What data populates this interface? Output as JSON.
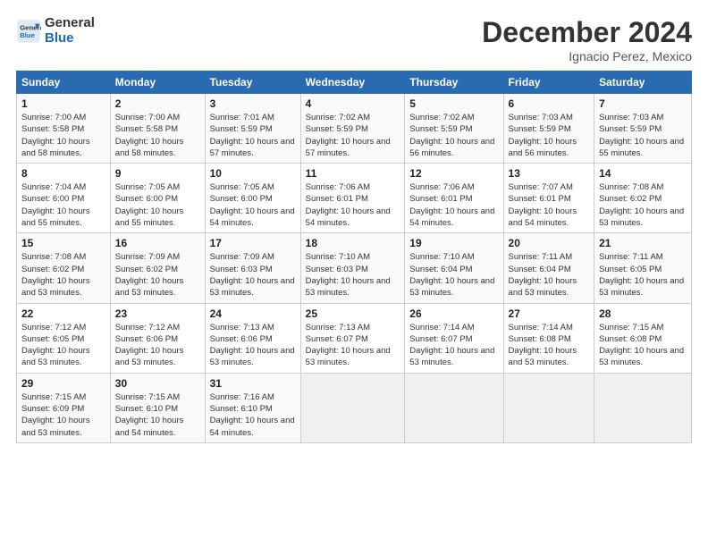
{
  "logo": {
    "general": "General",
    "blue": "Blue"
  },
  "header": {
    "title": "December 2024",
    "subtitle": "Ignacio Perez, Mexico"
  },
  "weekdays": [
    "Sunday",
    "Monday",
    "Tuesday",
    "Wednesday",
    "Thursday",
    "Friday",
    "Saturday"
  ],
  "weeks": [
    [
      {
        "day": "1",
        "sunrise": "7:00 AM",
        "sunset": "5:58 PM",
        "daylight": "10 hours and 58 minutes."
      },
      {
        "day": "2",
        "sunrise": "7:00 AM",
        "sunset": "5:58 PM",
        "daylight": "10 hours and 58 minutes."
      },
      {
        "day": "3",
        "sunrise": "7:01 AM",
        "sunset": "5:59 PM",
        "daylight": "10 hours and 57 minutes."
      },
      {
        "day": "4",
        "sunrise": "7:02 AM",
        "sunset": "5:59 PM",
        "daylight": "10 hours and 57 minutes."
      },
      {
        "day": "5",
        "sunrise": "7:02 AM",
        "sunset": "5:59 PM",
        "daylight": "10 hours and 56 minutes."
      },
      {
        "day": "6",
        "sunrise": "7:03 AM",
        "sunset": "5:59 PM",
        "daylight": "10 hours and 56 minutes."
      },
      {
        "day": "7",
        "sunrise": "7:03 AM",
        "sunset": "5:59 PM",
        "daylight": "10 hours and 55 minutes."
      }
    ],
    [
      {
        "day": "8",
        "sunrise": "7:04 AM",
        "sunset": "6:00 PM",
        "daylight": "10 hours and 55 minutes."
      },
      {
        "day": "9",
        "sunrise": "7:05 AM",
        "sunset": "6:00 PM",
        "daylight": "10 hours and 55 minutes."
      },
      {
        "day": "10",
        "sunrise": "7:05 AM",
        "sunset": "6:00 PM",
        "daylight": "10 hours and 54 minutes."
      },
      {
        "day": "11",
        "sunrise": "7:06 AM",
        "sunset": "6:01 PM",
        "daylight": "10 hours and 54 minutes."
      },
      {
        "day": "12",
        "sunrise": "7:06 AM",
        "sunset": "6:01 PM",
        "daylight": "10 hours and 54 minutes."
      },
      {
        "day": "13",
        "sunrise": "7:07 AM",
        "sunset": "6:01 PM",
        "daylight": "10 hours and 54 minutes."
      },
      {
        "day": "14",
        "sunrise": "7:08 AM",
        "sunset": "6:02 PM",
        "daylight": "10 hours and 53 minutes."
      }
    ],
    [
      {
        "day": "15",
        "sunrise": "7:08 AM",
        "sunset": "6:02 PM",
        "daylight": "10 hours and 53 minutes."
      },
      {
        "day": "16",
        "sunrise": "7:09 AM",
        "sunset": "6:02 PM",
        "daylight": "10 hours and 53 minutes."
      },
      {
        "day": "17",
        "sunrise": "7:09 AM",
        "sunset": "6:03 PM",
        "daylight": "10 hours and 53 minutes."
      },
      {
        "day": "18",
        "sunrise": "7:10 AM",
        "sunset": "6:03 PM",
        "daylight": "10 hours and 53 minutes."
      },
      {
        "day": "19",
        "sunrise": "7:10 AM",
        "sunset": "6:04 PM",
        "daylight": "10 hours and 53 minutes."
      },
      {
        "day": "20",
        "sunrise": "7:11 AM",
        "sunset": "6:04 PM",
        "daylight": "10 hours and 53 minutes."
      },
      {
        "day": "21",
        "sunrise": "7:11 AM",
        "sunset": "6:05 PM",
        "daylight": "10 hours and 53 minutes."
      }
    ],
    [
      {
        "day": "22",
        "sunrise": "7:12 AM",
        "sunset": "6:05 PM",
        "daylight": "10 hours and 53 minutes."
      },
      {
        "day": "23",
        "sunrise": "7:12 AM",
        "sunset": "6:06 PM",
        "daylight": "10 hours and 53 minutes."
      },
      {
        "day": "24",
        "sunrise": "7:13 AM",
        "sunset": "6:06 PM",
        "daylight": "10 hours and 53 minutes."
      },
      {
        "day": "25",
        "sunrise": "7:13 AM",
        "sunset": "6:07 PM",
        "daylight": "10 hours and 53 minutes."
      },
      {
        "day": "26",
        "sunrise": "7:14 AM",
        "sunset": "6:07 PM",
        "daylight": "10 hours and 53 minutes."
      },
      {
        "day": "27",
        "sunrise": "7:14 AM",
        "sunset": "6:08 PM",
        "daylight": "10 hours and 53 minutes."
      },
      {
        "day": "28",
        "sunrise": "7:15 AM",
        "sunset": "6:08 PM",
        "daylight": "10 hours and 53 minutes."
      }
    ],
    [
      {
        "day": "29",
        "sunrise": "7:15 AM",
        "sunset": "6:09 PM",
        "daylight": "10 hours and 53 minutes."
      },
      {
        "day": "30",
        "sunrise": "7:15 AM",
        "sunset": "6:10 PM",
        "daylight": "10 hours and 54 minutes."
      },
      {
        "day": "31",
        "sunrise": "7:16 AM",
        "sunset": "6:10 PM",
        "daylight": "10 hours and 54 minutes."
      },
      null,
      null,
      null,
      null
    ]
  ],
  "labels": {
    "sunrise": "Sunrise:",
    "sunset": "Sunset:",
    "daylight": "Daylight:"
  }
}
